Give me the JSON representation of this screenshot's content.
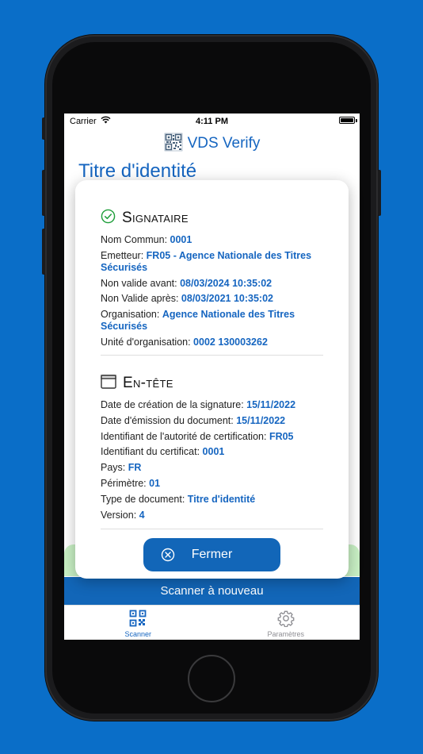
{
  "status_bar": {
    "carrier": "Carrier",
    "time": "4:11 PM"
  },
  "nav": {
    "title": "VDS Verify"
  },
  "page_title": "Titre d'identité",
  "signataire": {
    "title": "Signataire",
    "rows": [
      {
        "label": "Nom Commun: ",
        "value": "0001"
      },
      {
        "label": "Emetteur: ",
        "value": "FR05 - Agence Nationale des Titres Sécurisés"
      },
      {
        "label": "Non valide avant: ",
        "value": "08/03/2024 10:35:02"
      },
      {
        "label": "Non Valide après: ",
        "value": "08/03/2021 10:35:02"
      },
      {
        "label": "Organisation: ",
        "value": "Agence Nationale des Titres Sécurisés"
      },
      {
        "label": "Unité d'organisation: ",
        "value": "0002 130003262"
      }
    ]
  },
  "entete": {
    "title": "En-tête",
    "rows": [
      {
        "label": "Date de création de la signature: ",
        "value": "15/11/2022"
      },
      {
        "label": "Date d'émission du document: ",
        "value": "15/11/2022"
      },
      {
        "label": "Identifiant de l'autorité de certification: ",
        "value": "FR05"
      },
      {
        "label": "Identifiant du certificat: ",
        "value": "0001"
      },
      {
        "label": "Pays: ",
        "value": "FR"
      },
      {
        "label": "Périmètre: ",
        "value": "01"
      },
      {
        "label": "Type de document: ",
        "value": "Titre d'identité"
      },
      {
        "label": "Version: ",
        "value": "4"
      }
    ]
  },
  "close_button": {
    "label": "Fermer"
  },
  "scan_again": {
    "label": "Scanner à nouveau"
  },
  "tabs": [
    {
      "label": "Scanner",
      "icon": "qr-code-icon",
      "active": true
    },
    {
      "label": "Paramètres",
      "icon": "gear-icon",
      "active": false
    }
  ],
  "colors": {
    "accent": "#1565c0",
    "button": "#1266b8",
    "background": "#0a6ec8",
    "success": "#1e9e3a"
  }
}
